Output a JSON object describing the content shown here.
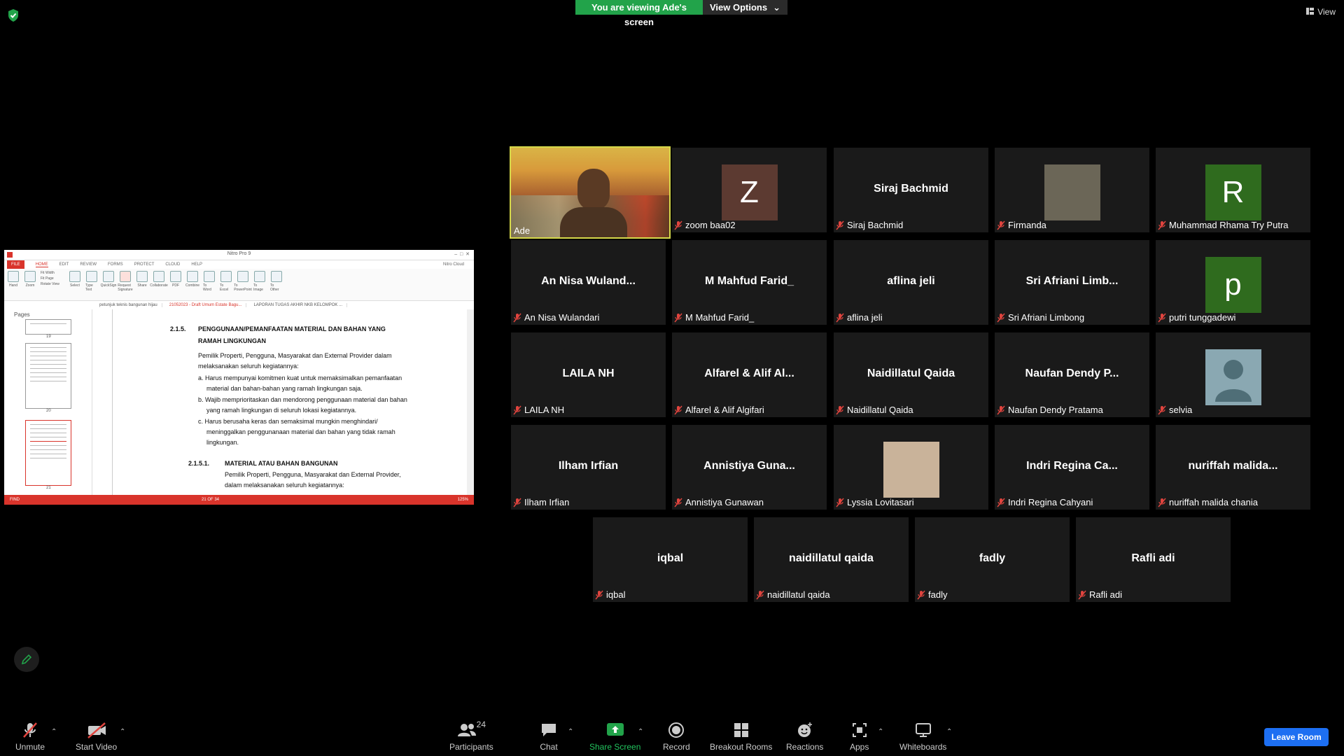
{
  "banner": {
    "viewing": "You are viewing Ade's screen",
    "view_options": "View Options"
  },
  "top_right": {
    "view": "View"
  },
  "shared_screen": {
    "app_title": "Nitro Pro 9",
    "menu": [
      "FILE",
      "HOME",
      "EDIT",
      "REVIEW",
      "FORMS",
      "PROTECT",
      "CLOUD",
      "HELP"
    ],
    "account": "Nitro Cloud",
    "ribbon": [
      "Hand",
      "Zoom",
      "Select",
      "Type Text",
      "QuickSign",
      "Request Signature",
      "Share",
      "Collaborate",
      "PDF",
      "Combine",
      "To Word",
      "To Excel",
      "To PowerPoint",
      "To Image",
      "To Other"
    ],
    "ribbon_small": [
      "Fit Width",
      "Fit Page",
      "Rotate View"
    ],
    "tabs": [
      "petunjuk teknis bangunan hijau",
      "21052023 - Draft Umum Estate Bagu...",
      "LAPORAN TUGAS AKHIR NKB KELOMPOK ..."
    ],
    "pages_label": "Pages",
    "thumb_numbers": [
      "19",
      "20",
      "21"
    ],
    "doc_lines": [
      {
        "t": "2.1.5.",
        "bold": true
      },
      {
        "t": "PENGGUNAAN/PEMANFAATAN MATERIAL DAN BAHAN YANG",
        "bold": true
      },
      {
        "t": "RAMAH LINGKUNGAN",
        "bold": true
      },
      {
        "t": "Pemilik Properti, Pengguna, Masyarakat dan External Provider dalam"
      },
      {
        "t": "melaksanakan seluruh kegiatannya:"
      },
      {
        "t": "a. Harus mempunyai komitmen kuat untuk memaksimalkan pemanfaatan"
      },
      {
        "t": "material dan bahan-bahan yang ramah lingkungan saja."
      },
      {
        "t": "b. Wajib memprioritaskan dan mendorong penggunaan material dan bahan"
      },
      {
        "t": "yang ramah lingkungan di seluruh lokasi kegiatannya."
      },
      {
        "t": "c. Harus berusaha keras dan semaksimal mungkin menghindari/"
      },
      {
        "t": "meninggalkan penggunanaan material dan bahan yang tidak ramah"
      },
      {
        "t": "lingkungan."
      },
      {
        "t": "2.1.5.1.",
        "bold": true
      },
      {
        "t": "MATERIAL ATAU BAHAN BANGUNAN",
        "bold": true
      },
      {
        "t": "Pemilik Properti, Pengguna, Masyarakat dan External Provider,"
      },
      {
        "t": "dalam melaksanakan seluruh kegiatannya:"
      }
    ],
    "status_left": "FIND",
    "page_counter": "21 OF 34",
    "zoom": "125%"
  },
  "participants_tiles": [
    {
      "display": "",
      "label": "Ade",
      "kind": "video"
    },
    {
      "display": "Z",
      "label": "zoom baa02",
      "kind": "avatar",
      "color": "#5c3a31"
    },
    {
      "display": "Siraj Bachmid",
      "label": "Siraj Bachmid",
      "kind": "name"
    },
    {
      "display": "",
      "label": "Firmanda",
      "kind": "photo",
      "color": "#6b6657"
    },
    {
      "display": "R",
      "label": "Muhammad Rhama Try Putra",
      "kind": "avatar",
      "color": "#2f6b1e"
    },
    {
      "display": "An Nisa Wuland...",
      "label": "An Nisa Wulandari",
      "kind": "name"
    },
    {
      "display": "M Mahfud Farid_",
      "label": "M Mahfud Farid_",
      "kind": "name"
    },
    {
      "display": "aflina jeli",
      "label": "aflina jeli",
      "kind": "name"
    },
    {
      "display": "Sri Afriani Limb...",
      "label": "Sri Afriani Limbong",
      "kind": "name"
    },
    {
      "display": "p",
      "label": "putri tunggadewi",
      "kind": "avatar",
      "color": "#2f6b1e"
    },
    {
      "display": "LAILA NH",
      "label": "LAILA NH",
      "kind": "name"
    },
    {
      "display": "Alfarel & Alif Al...",
      "label": "Alfarel & Alif Algifari",
      "kind": "name"
    },
    {
      "display": "Naidillatul Qaida",
      "label": "Naidillatul Qaida",
      "kind": "name"
    },
    {
      "display": "Naufan Dendy P...",
      "label": "Naufan Dendy Pratama",
      "kind": "name"
    },
    {
      "display": "",
      "label": "selvia",
      "kind": "default-avatar",
      "color": "#8aa8b2"
    },
    {
      "display": "Ilham Irfian",
      "label": "Ilham Irfian",
      "kind": "name"
    },
    {
      "display": "Annistiya Guna...",
      "label": "Annistiya Gunawan",
      "kind": "name"
    },
    {
      "display": "",
      "label": "Lyssia Lovitasari",
      "kind": "photo",
      "color": "#c9b39a"
    },
    {
      "display": "Indri Regina Ca...",
      "label": "Indri Regina Cahyani",
      "kind": "name"
    },
    {
      "display": "nuriffah  malida...",
      "label": "nuriffah malida chania",
      "kind": "name"
    },
    {
      "display": "iqbal",
      "label": "iqbal",
      "kind": "name"
    },
    {
      "display": "naidillatul qaida",
      "label": "naidillatul qaida",
      "kind": "name"
    },
    {
      "display": "fadly",
      "label": "fadly",
      "kind": "name"
    },
    {
      "display": "Rafli adi",
      "label": "Rafli adi",
      "kind": "name"
    }
  ],
  "toolbar": {
    "unmute": "Unmute",
    "start_video": "Start Video",
    "participants": "Participants",
    "participants_count": "24",
    "chat": "Chat",
    "share_screen": "Share Screen",
    "record": "Record",
    "breakout_rooms": "Breakout Rooms",
    "reactions": "Reactions",
    "apps": "Apps",
    "whiteboards": "Whiteboards",
    "leave_room": "Leave Room"
  },
  "colors": {
    "share_green": "#22a34a",
    "leave_blue": "#1d6ff2",
    "active_border": "#d6d94a",
    "muted_red": "#e0443e"
  }
}
